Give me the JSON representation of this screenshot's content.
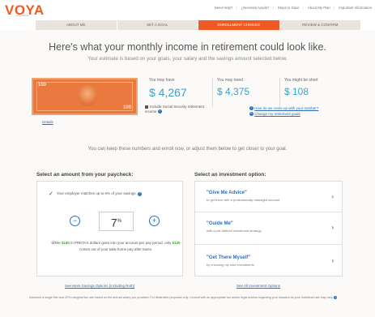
{
  "brand": {
    "logo": "VOYA",
    "tagline": "FINANCIAL"
  },
  "top_links": [
    "Need Help?",
    "¿Necesita Ayuda?",
    "Steps to Save",
    "About My Plan",
    "Important Information"
  ],
  "tabs": [
    {
      "label": "ABOUT ME",
      "active": false
    },
    {
      "label": "SET A GOAL",
      "active": false
    },
    {
      "label": "ENROLLMENT CHOICES",
      "active": true
    },
    {
      "label": "REVIEW & CONFIRM",
      "active": false
    }
  ],
  "hero": {
    "headline": "Here's what your monthly income in retirement could look like.",
    "subline": "Your estimate is based on your goals, your salary and the savings amount selected below."
  },
  "bill": {
    "corner_value": "100",
    "details_link": "Details"
  },
  "summary": {
    "may_have": {
      "label": "You may have",
      "value": "$ 4,267"
    },
    "may_need": {
      "label": "You may need",
      "value": "$ 4,375"
    },
    "short": {
      "label": "You might be short",
      "value": "$ 108"
    },
    "ss_note": "Include Social Security retirement income",
    "links": [
      "How do we come up with your number?",
      "Change my retirement goals"
    ]
  },
  "keep_text": "You can keep these numbers and enroll now, or adjust them below to get closer to your goal.",
  "paycheck": {
    "title": "Select an amount from your paycheck:",
    "match_text": "Your employer matches up to 6% of your savings.",
    "percent": "7",
    "percent_sign": "%",
    "minus": "−",
    "plus": "+",
    "pretax_prefix": "While ",
    "pretax_amount": "$180",
    "pretax_mid": " in PRETAX dollars goes into your account per pay period, only ",
    "net_amount": "$135",
    "pretax_suffix": " comes out of your take-home pay after taxes.",
    "see_more": "See More Savings Options (including Roth)"
  },
  "investment": {
    "title": "Select an investment option:",
    "options": [
      {
        "title": "\"Give Me Advice\"",
        "desc": "to get there with a professionally managed account"
      },
      {
        "title": "\"Guide Me\"",
        "desc": "with a pre-defined investment strategy"
      },
      {
        "title": "\"Get There Myself\"",
        "desc": "by choosing my own investments"
      }
    ],
    "see_all": "See All Investment Options"
  },
  "footnote": "Assumes a single filer and 22% marginal tax rate based on the annual salary you provided. For illustrative purposes only. Consult with an appropriate tax and/or legal advisor regarding your situation as your individual rate may vary.",
  "colors": {
    "brand_orange": "#f05a22",
    "accent_blue": "#2c6fb7",
    "value_blue": "#3aa2c9",
    "check_green": "#4aa43a"
  }
}
